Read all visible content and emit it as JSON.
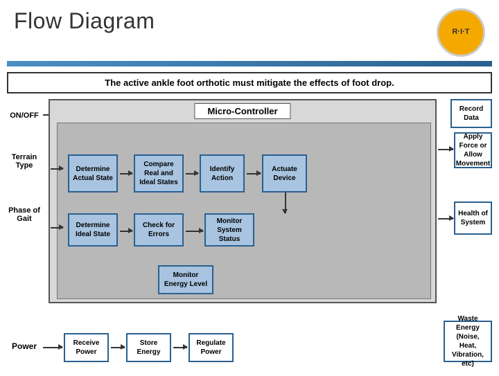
{
  "header": {
    "title": "Flow Diagram",
    "logo_text": "R·I·T"
  },
  "mission": {
    "text": "The active ankle foot orthotic must mitigate the effects of foot drop."
  },
  "labels": {
    "on_off": "ON/OFF",
    "terrain_type": "Terrain Type",
    "phase_of_gait": "Phase of Gait",
    "power": "Power",
    "micro_controller": "Micro-Controller",
    "record_data": "Record Data",
    "determine_actual_state": "Determine Actual State",
    "compare_real_ideal": "Compare Real and Ideal States",
    "identify_action": "Identify Action",
    "actuate_device": "Actuate Device",
    "apply_force": "Apply Force or Allow Movement",
    "determine_ideal_state": "Determine Ideal State",
    "check_errors": "Check for Errors",
    "monitor_system_status": "Monitor System Status",
    "health_system": "Health of System",
    "monitor_energy": "Monitor Energy Level",
    "receive_power": "Receive Power",
    "store_energy": "Store Energy",
    "regulate_power": "Regulate Power",
    "waste_energy": "Waste Energy (Noise, Heat, Vibration, etc)"
  }
}
